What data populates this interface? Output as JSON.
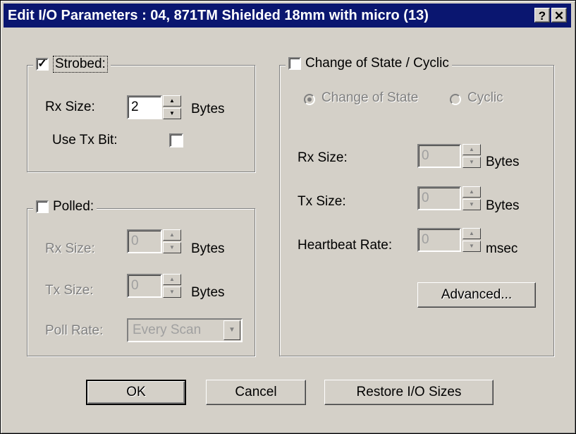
{
  "window": {
    "title": "Edit I/O Parameters : 04, 871TM Shielded 18mm with micro (13)",
    "help_label": "?",
    "close_label": "✕"
  },
  "strobed": {
    "label": "Strobed:",
    "checked": true,
    "rx_label": "Rx Size:",
    "rx_value": "2",
    "rx_unit": "Bytes",
    "use_tx_label": "Use Tx Bit:",
    "use_tx_checked": false
  },
  "polled": {
    "label": "Polled:",
    "checked": false,
    "rx_label": "Rx Size:",
    "rx_value": "0",
    "rx_unit": "Bytes",
    "tx_label": "Tx Size:",
    "tx_value": "0",
    "tx_unit": "Bytes",
    "rate_label": "Poll Rate:",
    "rate_value": "Every Scan"
  },
  "cos": {
    "label": "Change of State / Cyclic",
    "checked": false,
    "radio_cos_label": "Change of State",
    "radio_cyclic_label": "Cyclic",
    "selected": "Change of State",
    "rx_label": "Rx Size:",
    "rx_value": "0",
    "rx_unit": "Bytes",
    "tx_label": "Tx Size:",
    "tx_value": "0",
    "tx_unit": "Bytes",
    "hb_label": "Heartbeat Rate:",
    "hb_value": "0",
    "hb_unit": "msec",
    "advanced_label": "Advanced..."
  },
  "buttons": {
    "ok": "OK",
    "cancel": "Cancel",
    "restore": "Restore I/O Sizes"
  },
  "colors": {
    "titlebar": "#0a1670",
    "face": "#d4d0c8",
    "disabled_text": "#808080"
  }
}
